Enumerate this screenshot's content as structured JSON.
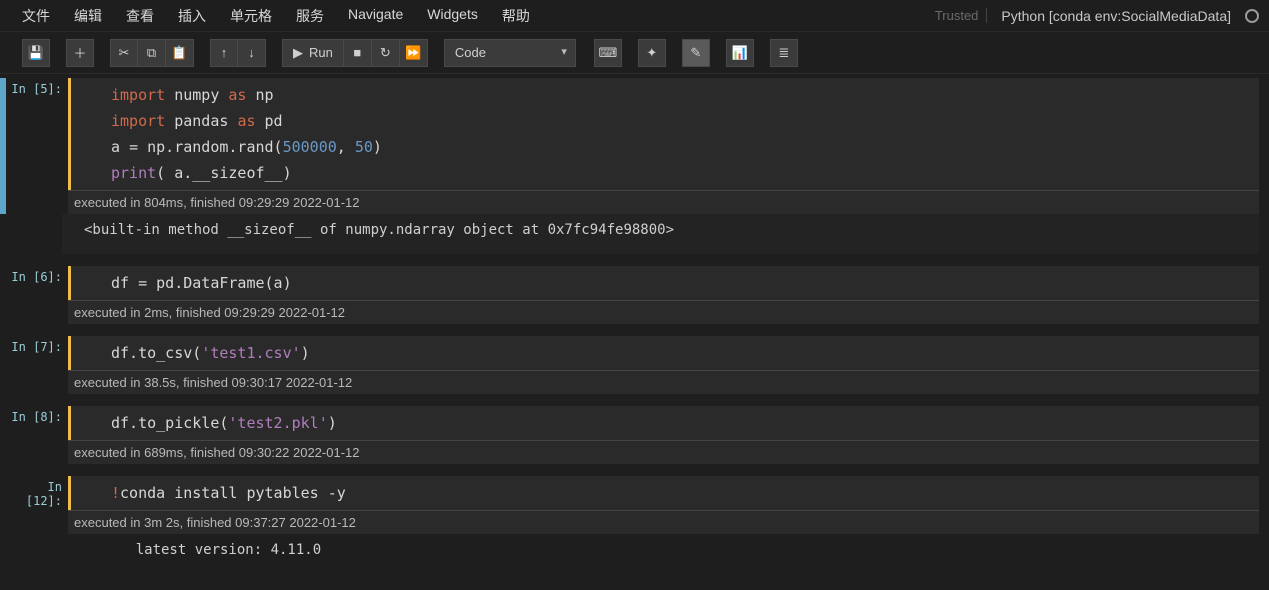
{
  "menubar": {
    "items": [
      "文件",
      "编辑",
      "查看",
      "插入",
      "单元格",
      "服务",
      "Navigate",
      "Widgets",
      "帮助"
    ],
    "trusted_label": "Trusted",
    "kernel_name": "Python [conda env:SocialMediaData]"
  },
  "toolbar": {
    "save_title": "保存",
    "add_title": "添加单元格",
    "cut_title": "剪切",
    "copy_title": "复制",
    "paste_title": "粘贴",
    "move_up_title": "上移",
    "move_down_title": "下移",
    "run_label": "Run",
    "stop_title": "中断",
    "restart_title": "重启",
    "restart_run_title": "重启并运行",
    "cell_type_selected": "Code",
    "cmd_palette_title": "命令面板",
    "scratchpad_title": "Scratchpad",
    "drafting_title": "草图",
    "chart_title": "图表",
    "list_title": "列表"
  },
  "cells": [
    {
      "prompt": "In [5]:",
      "code_html": "<span class='kw'>import</span> <span class='mod'>numpy</span> <span class='kw2'>as</span> <span class='mod'>np</span>\n<span class='kw'>import</span> <span class='mod'>pandas</span> <span class='kw2'>as</span> <span class='mod'>pd</span>\na <span class='op'>=</span> np.random.rand(<span class='num'>500000</span>, <span class='num'>50</span>)\n<span class='fn'>print</span>( a.__sizeof__)",
      "timing": "executed in 804ms, finished 09:29:29 2022-01-12",
      "output": "<built-in method __sizeof__ of numpy.ndarray object at 0x7fc94fe98800>"
    },
    {
      "prompt": "In [6]:",
      "code_html": "df <span class='op'>=</span> pd.DataFrame(a)",
      "timing": "executed in 2ms, finished 09:29:29 2022-01-12"
    },
    {
      "prompt": "In [7]:",
      "code_html": "df.to_csv(<span class='str'>'test1.csv'</span>)",
      "timing": "executed in 38.5s, finished 09:30:17 2022-01-12"
    },
    {
      "prompt": "In [8]:",
      "code_html": "df.to_pickle(<span class='str'>'test2.pkl'</span>)",
      "timing": "executed in 689ms, finished 09:30:22 2022-01-12"
    },
    {
      "prompt": "In [12]:",
      "code_html": "<span class='bang'>!</span>conda install pytables <span class='op'>-</span>y",
      "timing": "executed in 3m 2s, finished 09:37:27 2022-01-12",
      "stream": "    latest version: 4.11.0"
    }
  ],
  "icons": {
    "save": "💾",
    "add": "＋",
    "cut": "✂",
    "copy": "⧉",
    "paste": "📋",
    "up": "↑",
    "down": "↓",
    "run": "▶",
    "stop": "■",
    "restart": "↻",
    "ff": "⏩",
    "keyboard": "⌨",
    "diamond": "✦",
    "pencil": "✎",
    "bar": "📊",
    "list": "≣"
  }
}
